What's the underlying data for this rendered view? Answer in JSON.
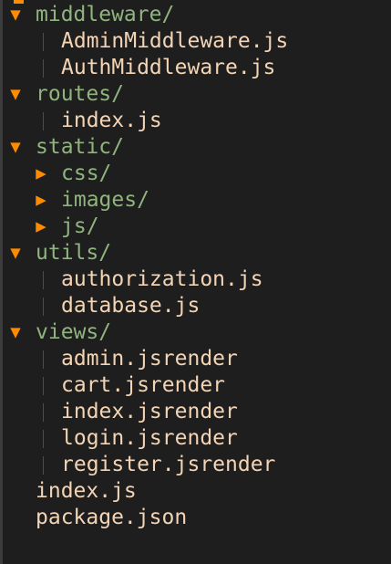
{
  "colors": {
    "background": "#1e1e1e",
    "arrow": "#ff8c00",
    "folder_text": "#8fb47e",
    "file_text": "#f3d4b5",
    "guide_line": "#4d4d4d"
  },
  "icons": {
    "expanded": "expanded-arrow-icon",
    "collapsed": "collapsed-arrow-icon"
  },
  "glyphs": {
    "expanded": "▼",
    "collapsed": "▶"
  },
  "tree": [
    {
      "type": "folder",
      "label": "middleware/",
      "expanded": true,
      "depth": 0
    },
    {
      "type": "file",
      "label": "AdminMiddleware.js",
      "depth": 1
    },
    {
      "type": "file",
      "label": "AuthMiddleware.js",
      "depth": 1
    },
    {
      "type": "folder",
      "label": "routes/",
      "expanded": true,
      "depth": 0
    },
    {
      "type": "file",
      "label": "index.js",
      "depth": 1
    },
    {
      "type": "folder",
      "label": "static/",
      "expanded": true,
      "depth": 0
    },
    {
      "type": "folder",
      "label": "css/",
      "expanded": false,
      "depth": 1
    },
    {
      "type": "folder",
      "label": "images/",
      "expanded": false,
      "depth": 1
    },
    {
      "type": "folder",
      "label": "js/",
      "expanded": false,
      "depth": 1
    },
    {
      "type": "folder",
      "label": "utils/",
      "expanded": true,
      "depth": 0
    },
    {
      "type": "file",
      "label": "authorization.js",
      "depth": 1
    },
    {
      "type": "file",
      "label": "database.js",
      "depth": 1
    },
    {
      "type": "folder",
      "label": "views/",
      "expanded": true,
      "depth": 0
    },
    {
      "type": "file",
      "label": "admin.jsrender",
      "depth": 1
    },
    {
      "type": "file",
      "label": "cart.jsrender",
      "depth": 1
    },
    {
      "type": "file",
      "label": "index.jsrender",
      "depth": 1
    },
    {
      "type": "file",
      "label": "login.jsrender",
      "depth": 1
    },
    {
      "type": "file",
      "label": "register.jsrender",
      "depth": 1
    },
    {
      "type": "file",
      "label": "index.js",
      "depth": 0
    },
    {
      "type": "file",
      "label": "package.json",
      "depth": 0
    }
  ]
}
